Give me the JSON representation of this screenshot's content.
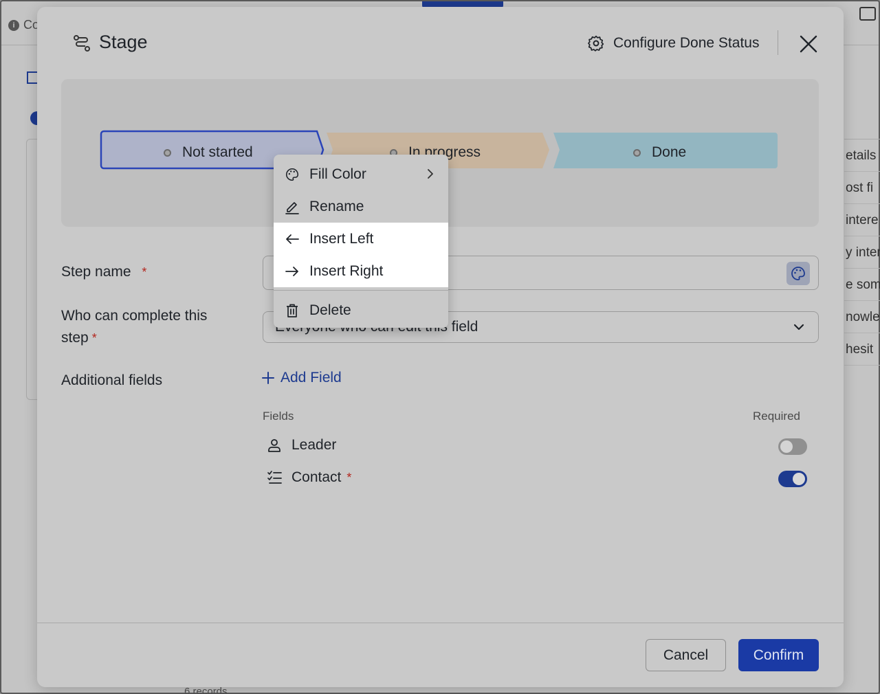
{
  "background": {
    "info_text": "Co",
    "right_column": [
      "etails",
      "ost fi",
      "intere",
      "y inter",
      "e som",
      "nowle",
      "hesit"
    ],
    "footer_text": "6 records"
  },
  "modal": {
    "title": "Stage",
    "config_label": "Configure Done Status"
  },
  "stages": [
    {
      "label": "Not started",
      "color": "#aeb3c9"
    },
    {
      "label": "In progress",
      "color": "#c8b49d"
    },
    {
      "label": "Done",
      "color": "#93b6c1"
    }
  ],
  "context_menu": {
    "items": [
      {
        "label": "Fill Color",
        "icon": "palette-icon"
      },
      {
        "label": "Rename",
        "icon": "pencil-icon"
      },
      {
        "label": "Insert Left",
        "icon": "arrow-left-icon"
      },
      {
        "label": "Insert Right",
        "icon": "arrow-right-icon"
      },
      {
        "label": "Delete",
        "icon": "trash-icon"
      }
    ]
  },
  "form": {
    "step_name_label": "Step name",
    "who_label_line1": "Who can complete this",
    "who_label_line2": "step",
    "who_value": "Everyone who can edit this field",
    "additional_label": "Additional fields",
    "add_field_label": "Add Field",
    "fields_header": "Fields",
    "required_header": "Required",
    "fields": [
      {
        "label": "Leader",
        "required": false,
        "icon": "person-icon"
      },
      {
        "label": "Contact",
        "required": true,
        "icon": "checklist-icon"
      }
    ]
  },
  "footer": {
    "cancel_label": "Cancel",
    "confirm_label": "Confirm"
  },
  "colors": {
    "accent": "#1d3a8f",
    "required_star": "#b3261e"
  }
}
